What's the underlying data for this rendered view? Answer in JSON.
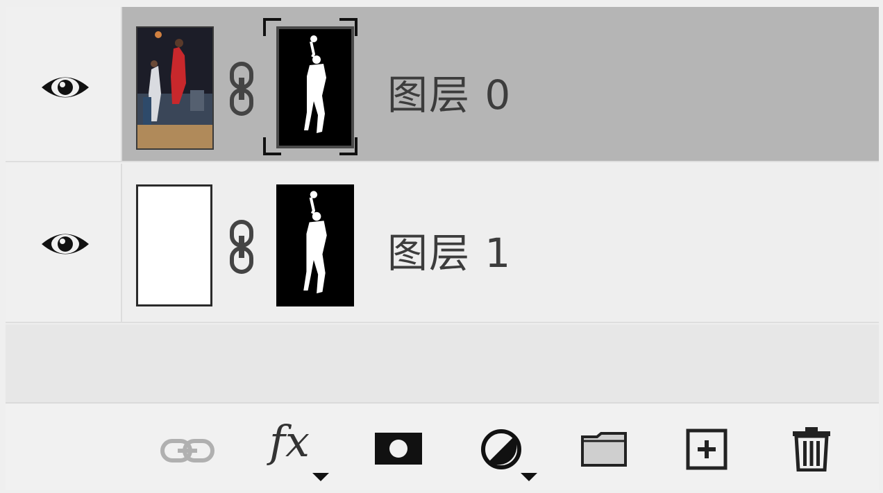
{
  "layers": [
    {
      "name": "图层 0",
      "selected": true,
      "visible": true,
      "thumbnail": "photo-basketball-player",
      "linked": true,
      "mask": "player-silhouette",
      "mask_selected": true
    },
    {
      "name": "图层 1",
      "selected": false,
      "visible": true,
      "thumbnail": "white-fill",
      "linked": true,
      "mask": "player-silhouette",
      "mask_selected": false
    }
  ],
  "toolbar": {
    "fx_label": "fx",
    "icons": [
      "link-layers-icon",
      "fx-icon",
      "add-mask-icon",
      "adjustment-layer-icon",
      "new-group-icon",
      "new-layer-icon",
      "delete-icon"
    ]
  },
  "colors": {
    "selected_row": "#b5b5b5",
    "row": "#eeeeee",
    "mask_bg": "#000000"
  }
}
